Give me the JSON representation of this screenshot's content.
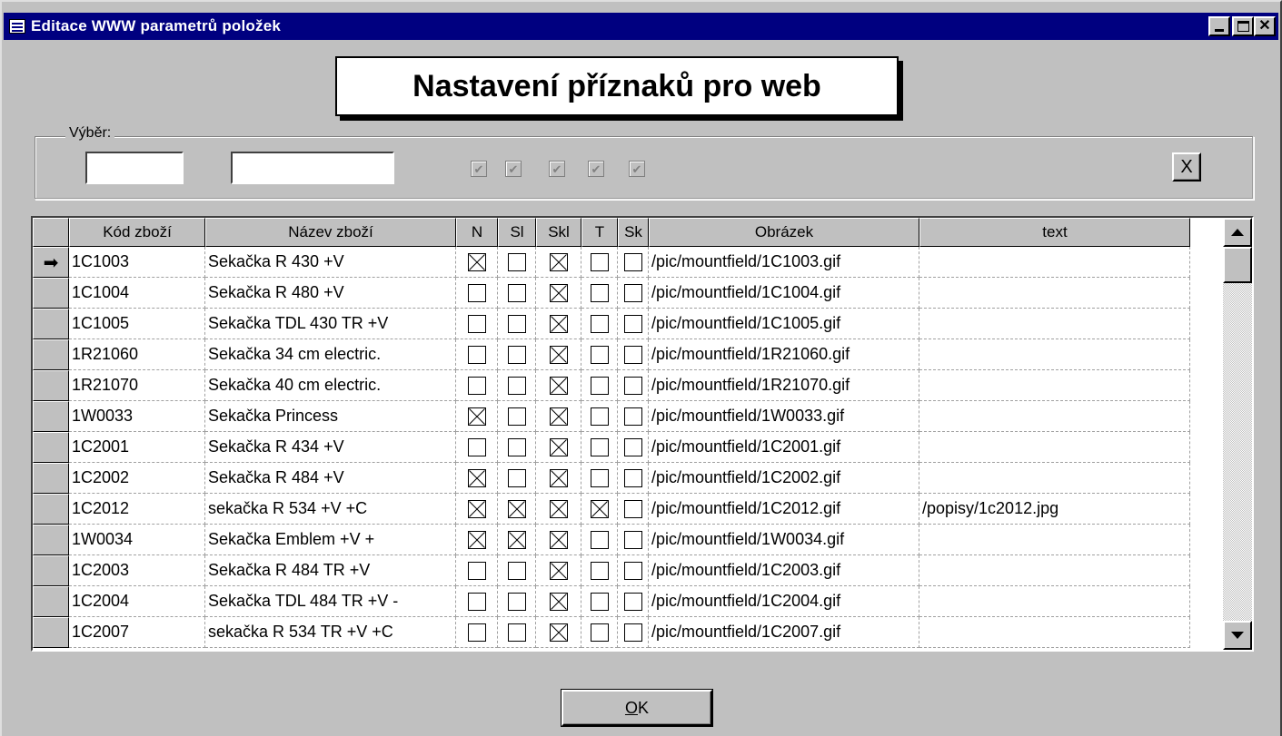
{
  "window": {
    "title": "Editace WWW parametrů položek",
    "minimize_label": "",
    "maximize_label": "",
    "close_label": "✕"
  },
  "heading": "Nastavení příznaků pro web",
  "filter": {
    "legend": "Výběr:",
    "code_value": "",
    "name_value": "",
    "flags": [
      true,
      true,
      true,
      true,
      true
    ],
    "clear_label": "X"
  },
  "grid": {
    "columns": [
      "Kód zboží",
      "Název zboží",
      "N",
      "Sl",
      "Skl",
      "T",
      "Sk",
      "Obrázek",
      "text"
    ],
    "current_row_marker": "➡",
    "rows": [
      {
        "code": "1C1003",
        "name": "Sekačka R 430 +V",
        "flags": [
          true,
          false,
          true,
          false,
          false
        ],
        "image": "/pic/mountfield/1C1003.gif",
        "text": ""
      },
      {
        "code": "1C1004",
        "name": "Sekačka R 480 +V",
        "flags": [
          false,
          false,
          true,
          false,
          false
        ],
        "image": "/pic/mountfield/1C1004.gif",
        "text": ""
      },
      {
        "code": "1C1005",
        "name": "Sekačka TDL 430 TR +V",
        "flags": [
          false,
          false,
          true,
          false,
          false
        ],
        "image": "/pic/mountfield/1C1005.gif",
        "text": ""
      },
      {
        "code": "1R21060",
        "name": "Sekačka 34 cm electric.",
        "flags": [
          false,
          false,
          true,
          false,
          false
        ],
        "image": "/pic/mountfield/1R21060.gif",
        "text": ""
      },
      {
        "code": "1R21070",
        "name": "Sekačka 40 cm electric.",
        "flags": [
          false,
          false,
          true,
          false,
          false
        ],
        "image": "/pic/mountfield/1R21070.gif",
        "text": ""
      },
      {
        "code": "1W0033",
        "name": "Sekačka Princess",
        "flags": [
          true,
          false,
          true,
          false,
          false
        ],
        "image": "/pic/mountfield/1W0033.gif",
        "text": ""
      },
      {
        "code": "1C2001",
        "name": "Sekačka R 434 +V",
        "flags": [
          false,
          false,
          true,
          false,
          false
        ],
        "image": "/pic/mountfield/1C2001.gif",
        "text": ""
      },
      {
        "code": "1C2002",
        "name": "Sekačka R 484 +V",
        "flags": [
          true,
          false,
          true,
          false,
          false
        ],
        "image": "/pic/mountfield/1C2002.gif",
        "text": ""
      },
      {
        "code": "1C2012",
        "name": "sekačka R 534 +V          +C",
        "flags": [
          true,
          true,
          true,
          true,
          false
        ],
        "image": "/pic/mountfield/1C2012.gif",
        "text": "/popisy/1c2012.jpg"
      },
      {
        "code": "1W0034",
        "name": "Sekačka Emblem +V             +",
        "flags": [
          true,
          true,
          true,
          false,
          false
        ],
        "image": "/pic/mountfield/1W0034.gif",
        "text": ""
      },
      {
        "code": "1C2003",
        "name": "Sekačka R 484 TR +V",
        "flags": [
          false,
          false,
          true,
          false,
          false
        ],
        "image": "/pic/mountfield/1C2003.gif",
        "text": ""
      },
      {
        "code": "1C2004",
        "name": "Sekačka TDL 484 TR +V    -",
        "flags": [
          false,
          false,
          true,
          false,
          false
        ],
        "image": "/pic/mountfield/1C2004.gif",
        "text": ""
      },
      {
        "code": "1C2007",
        "name": "sekačka R 534 TR +V       +C",
        "flags": [
          false,
          false,
          true,
          false,
          false
        ],
        "image": "/pic/mountfield/1C2007.gif",
        "text": ""
      }
    ]
  },
  "ok_button": {
    "accel": "O",
    "rest": "K"
  },
  "icons": {
    "app": "form-window-icon",
    "minimize": "minimize-icon",
    "maximize": "maximize-icon",
    "close": "close-icon",
    "row_marker": "arrow-right-icon",
    "scroll_up": "scroll-up-icon",
    "scroll_down": "scroll-down-icon"
  },
  "colors": {
    "titlebar": "#000080",
    "face": "#c0c0c0",
    "grid_bg": "#ffffff"
  }
}
